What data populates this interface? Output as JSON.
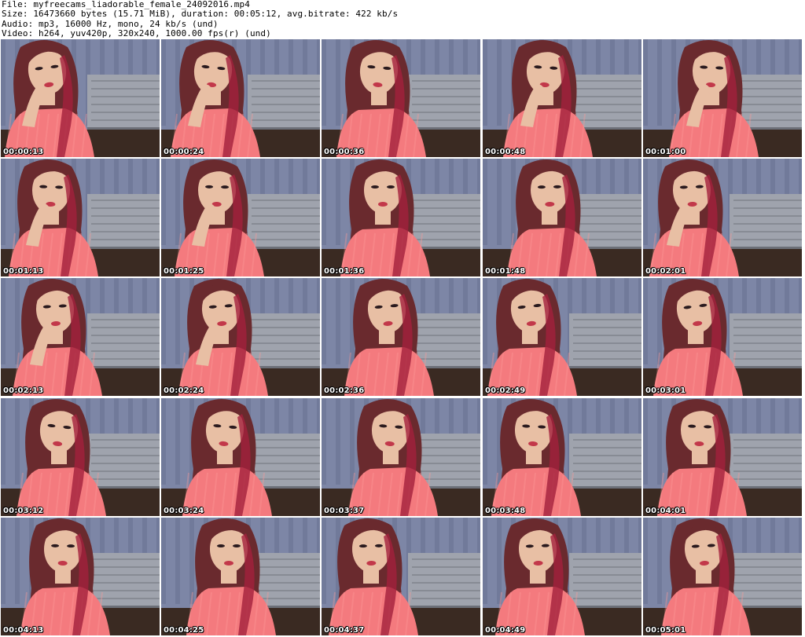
{
  "header": {
    "file_line": "File: myfreecams_liadorable_female_24092016.mp4",
    "size_line": "Size: 16473660 bytes (15.71 MiB), duration: 00:05:12, avg.bitrate: 422 kb/s",
    "audio_line": "Audio: mp3, 16000 Hz, mono, 24 kb/s (und)",
    "video_line": "Video: h264, yuv420p, 320x240, 1000.00 fps(r) (und)"
  },
  "thumbnails": [
    {
      "timestamp": "00:00:13"
    },
    {
      "timestamp": "00:00:24"
    },
    {
      "timestamp": "00:00:36"
    },
    {
      "timestamp": "00:00:48"
    },
    {
      "timestamp": "00:01:00"
    },
    {
      "timestamp": "00:01:13"
    },
    {
      "timestamp": "00:01:25"
    },
    {
      "timestamp": "00:01:36"
    },
    {
      "timestamp": "00:01:48"
    },
    {
      "timestamp": "00:02:01"
    },
    {
      "timestamp": "00:02:13"
    },
    {
      "timestamp": "00:02:24"
    },
    {
      "timestamp": "00:02:36"
    },
    {
      "timestamp": "00:02:49"
    },
    {
      "timestamp": "00:03:01"
    },
    {
      "timestamp": "00:03:12"
    },
    {
      "timestamp": "00:03:24"
    },
    {
      "timestamp": "00:03:37"
    },
    {
      "timestamp": "00:03:48"
    },
    {
      "timestamp": "00:04:01"
    },
    {
      "timestamp": "00:04:13"
    },
    {
      "timestamp": "00:04:25"
    },
    {
      "timestamp": "00:04:37"
    },
    {
      "timestamp": "00:04:49"
    },
    {
      "timestamp": "00:05:01"
    }
  ],
  "colors": {
    "wall": "#7d86a6",
    "wall_shadow": "#5d6584",
    "bed": "#9fa3ad",
    "bed_dark": "#6c6f78",
    "floor": "#3a2a22",
    "sweater": "#f47a7e",
    "sweater_light": "#ff9a98",
    "skin": "#e8bfa4",
    "hair": "#6a2a2e",
    "hair_tip": "#a3203c"
  }
}
